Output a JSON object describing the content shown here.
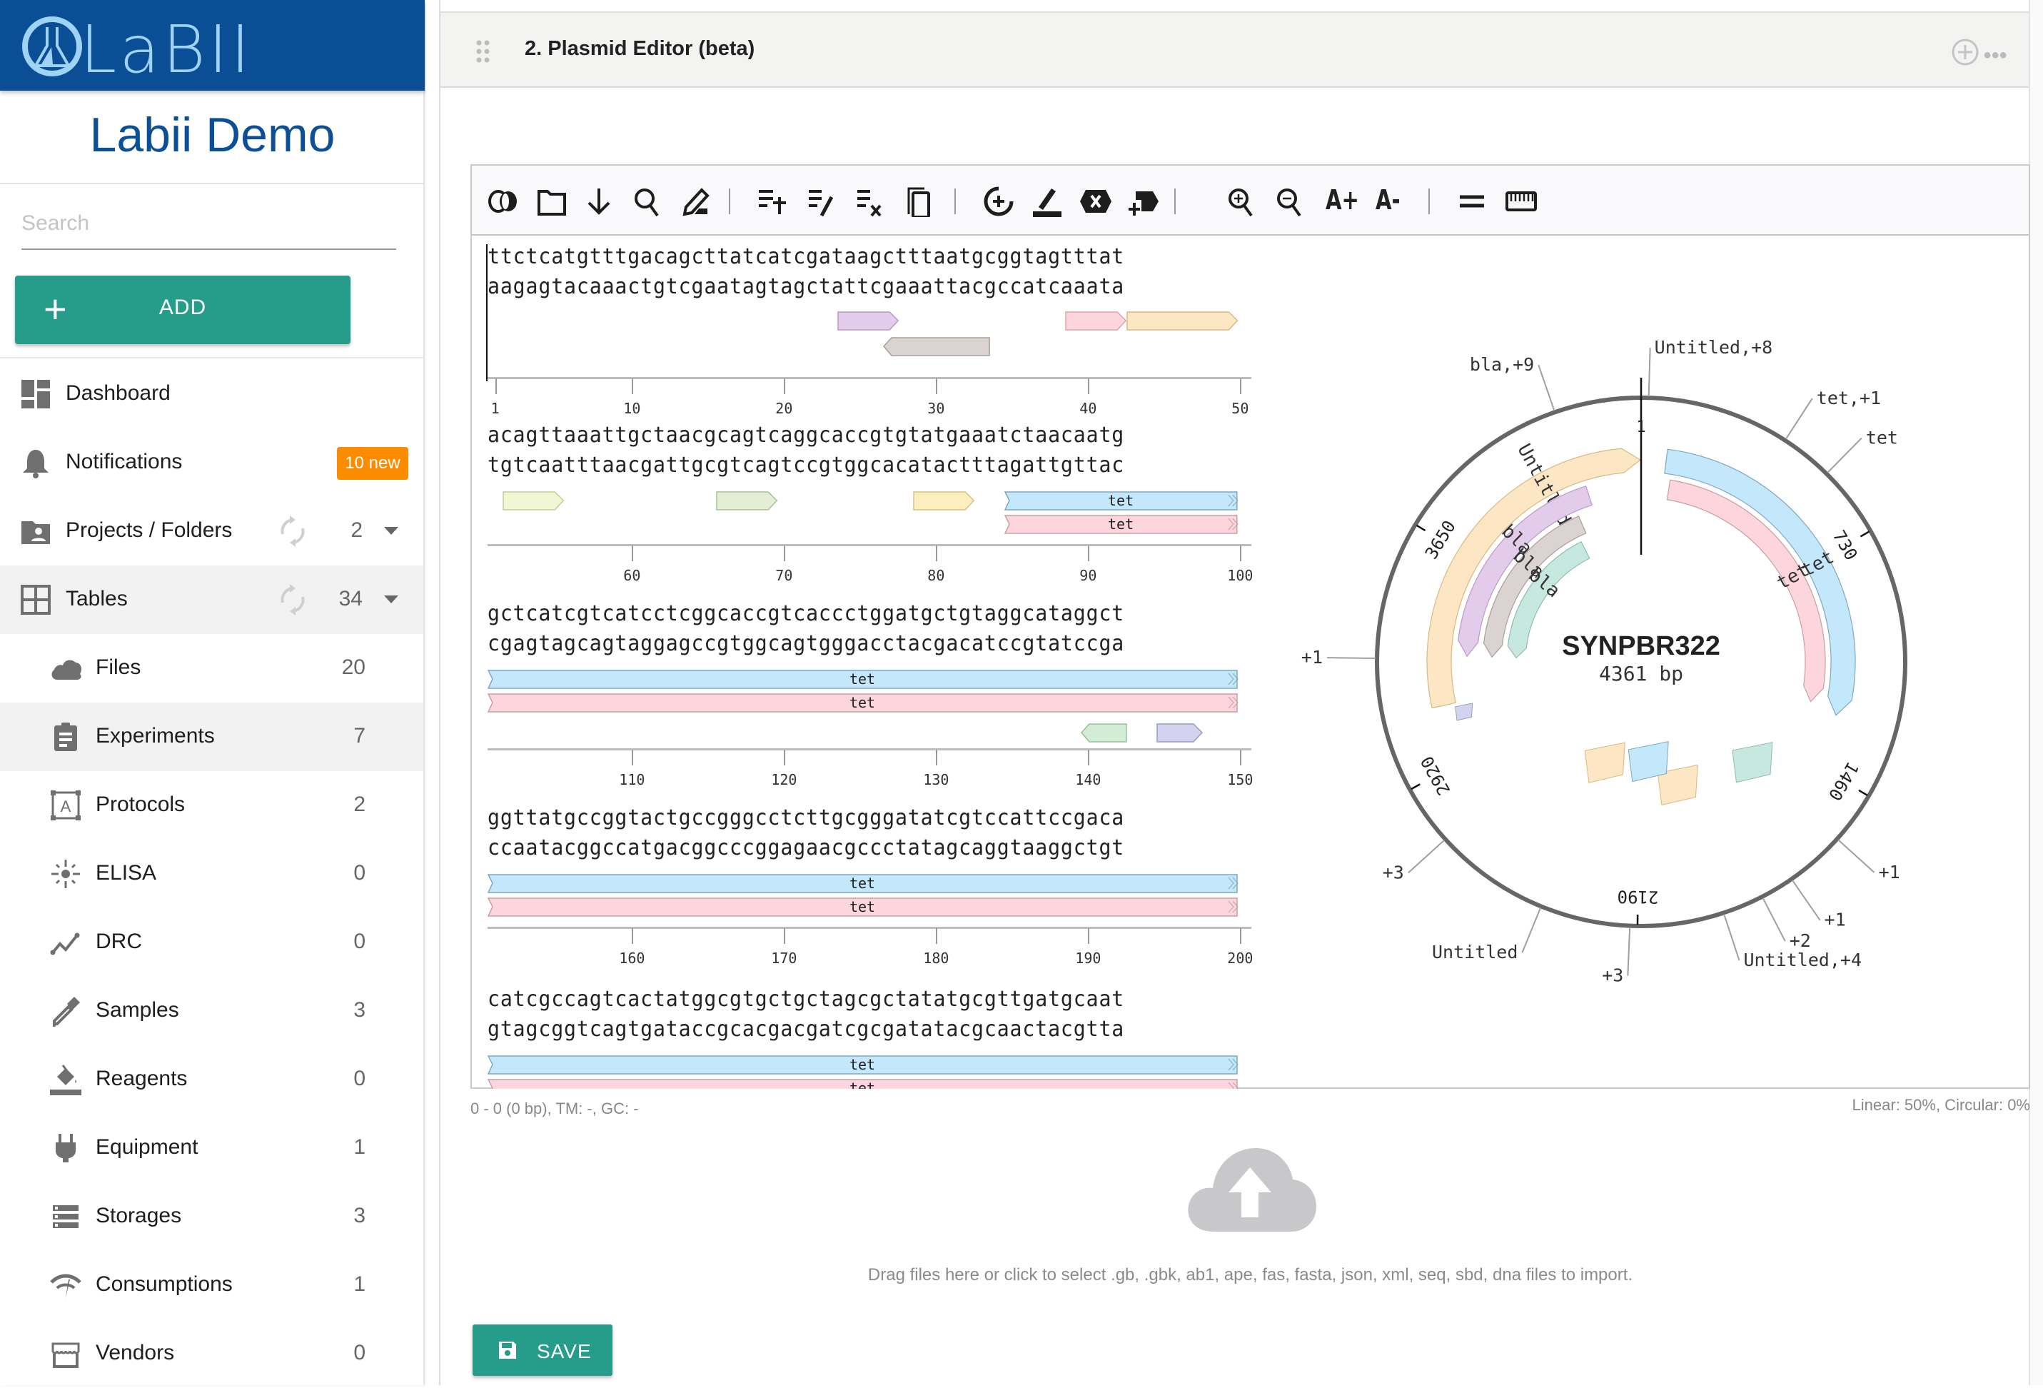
{
  "brand": {
    "logo_text": "LaBII",
    "org_name": "Labii Demo",
    "header_color": "#0a4f96"
  },
  "sidebar": {
    "search_placeholder": "Search",
    "search_value": "",
    "add_button": {
      "icon": "plus-icon",
      "label": "ADD"
    },
    "items": [
      {
        "id": "dashboard",
        "label": "Dashboard",
        "icon": "dashboard-icon",
        "level": 0
      },
      {
        "id": "notifications",
        "label": "Notifications",
        "icon": "bell-icon",
        "badge": "10 new",
        "level": 0
      },
      {
        "id": "projects",
        "label": "Projects / Folders",
        "icon": "folder-shared-icon",
        "count": "2",
        "sync": true,
        "expandable": true,
        "level": 0
      },
      {
        "id": "tables",
        "label": "Tables",
        "icon": "grid-icon",
        "count": "34",
        "sync": true,
        "expandable": true,
        "active": true,
        "level": 0
      },
      {
        "id": "files",
        "label": "Files",
        "icon": "cloud-icon",
        "count": "20",
        "level": 1
      },
      {
        "id": "experiments",
        "label": "Experiments",
        "icon": "clipboard-icon",
        "count": "7",
        "active": true,
        "level": 1
      },
      {
        "id": "protocols",
        "label": "Protocols",
        "icon": "text-box-icon",
        "count": "2",
        "level": 1
      },
      {
        "id": "elisa",
        "label": "ELISA",
        "icon": "sun-burst-icon",
        "count": "0",
        "level": 1
      },
      {
        "id": "drc",
        "label": "DRC",
        "icon": "line-chart-icon",
        "count": "0",
        "level": 1
      },
      {
        "id": "samples",
        "label": "Samples",
        "icon": "pipette-icon",
        "count": "3",
        "level": 1
      },
      {
        "id": "reagents",
        "label": "Reagents",
        "icon": "paint-bucket-icon",
        "count": "0",
        "level": 1
      },
      {
        "id": "equipment",
        "label": "Equipment",
        "icon": "plug-icon",
        "count": "1",
        "level": 1
      },
      {
        "id": "storages",
        "label": "Storages",
        "icon": "storage-icon",
        "count": "3",
        "level": 1
      },
      {
        "id": "consumptions",
        "label": "Consumptions",
        "icon": "gauge-icon",
        "count": "1",
        "level": 1
      },
      {
        "id": "vendors",
        "label": "Vendors",
        "icon": "store-icon",
        "count": "0",
        "level": 1
      }
    ],
    "badge_color": "#fb8c00",
    "accent_color": "#259d8a"
  },
  "panel": {
    "title": "2. Plasmid Editor (beta)",
    "add_icon": "add-circle-icon",
    "more_icon": "more-icon"
  },
  "toolbar": {
    "buttons": [
      {
        "id": "view-toggle",
        "icon": "circular-linear-view-icon"
      },
      {
        "id": "open",
        "icon": "folder-icon"
      },
      {
        "id": "download",
        "icon": "download-arrow-icon"
      },
      {
        "id": "find",
        "icon": "search-icon"
      },
      {
        "id": "edit",
        "icon": "pencil-icon"
      },
      {
        "sep": true
      },
      {
        "id": "add-feature",
        "icon": "list-add-icon"
      },
      {
        "id": "edit-feature",
        "icon": "list-edit-icon"
      },
      {
        "id": "remove-feature",
        "icon": "list-remove-icon"
      },
      {
        "id": "copy",
        "icon": "copy-icon"
      },
      {
        "sep": true
      },
      {
        "id": "add-primer",
        "icon": "circle-plus-icon"
      },
      {
        "id": "highlight",
        "icon": "highlight-icon"
      },
      {
        "id": "delete",
        "icon": "hex-x-icon"
      },
      {
        "id": "insert",
        "icon": "label-plus-icon"
      },
      {
        "sep": true
      },
      {
        "id": "zoom-in",
        "icon": "zoom-in-icon"
      },
      {
        "id": "zoom-out",
        "icon": "zoom-out-icon"
      },
      {
        "id": "font-increase",
        "text": "A+"
      },
      {
        "id": "font-decrease",
        "text": "A-"
      },
      {
        "sep": true
      },
      {
        "id": "complement-toggle",
        "icon": "equals-icon"
      },
      {
        "id": "ruler-toggle",
        "icon": "ruler-icon"
      }
    ]
  },
  "sequence": {
    "rows": [
      {
        "top": "ttctcatgtttgacagcttatcatcgataagctttaatgcggtagtttat",
        "bottom": "aagagtacaaactgtcgaatagtagctattcgaaattacgccatcaaata",
        "start": 1,
        "ticks": [
          1,
          10,
          20,
          30,
          40,
          50
        ],
        "features": [
          {
            "from": 24,
            "to": 27,
            "dir": "fwd",
            "lane": 0,
            "color": "#e3cbec",
            "stroke": "#b89cc4",
            "label": ""
          },
          {
            "from": 27,
            "to": 33,
            "dir": "rev",
            "lane": 1,
            "color": "#dbd3d1",
            "stroke": "#a89f9c",
            "label": ""
          },
          {
            "from": 39,
            "to": 42,
            "dir": "fwd",
            "lane": 0,
            "color": "#fdd5dc",
            "stroke": "#dca3ad",
            "label": ""
          },
          {
            "from": 43,
            "to": 50,
            "dir": "fwd",
            "lane": 0,
            "color": "#fde6c4",
            "stroke": "#d8b984",
            "label": ""
          }
        ]
      },
      {
        "top": "acagttaaattgctaacgcagtcaggcaccgtgtatgaaatctaacaatg",
        "bottom": "tgtcaatttaacgattgcgtcagtccgtggcacatactttagattgttac",
        "start": 51,
        "ticks": [
          60,
          70,
          80,
          90,
          100
        ],
        "features": [
          {
            "from": 52,
            "to": 55,
            "dir": "fwd",
            "lane": 0,
            "color": "#f1f7d5",
            "stroke": "#c5cc96",
            "label": ""
          },
          {
            "from": 66,
            "to": 69,
            "dir": "fwd",
            "lane": 0,
            "color": "#e3eed4",
            "stroke": "#a9bf96",
            "label": ""
          },
          {
            "from": 79,
            "to": 82,
            "dir": "fwd",
            "lane": 0,
            "color": "#fdeec0",
            "stroke": "#d8c27b",
            "label": ""
          },
          {
            "from": 85,
            "to": 100,
            "dir": "cont",
            "lane": 0,
            "color": "#c4e8fb",
            "stroke": "#7fa8c0",
            "label": "tet"
          },
          {
            "from": 85,
            "to": 100,
            "dir": "cont",
            "lane": 1,
            "color": "#fdd5dc",
            "stroke": "#c7a0a7",
            "label": "tet"
          }
        ]
      },
      {
        "top": "gctcatcgtcatcctcggcaccgtcaccctggatgctgtaggcataggct",
        "bottom": "cgagtagcagtaggagccgtggcagtgggacctacgacatccgtatccga",
        "start": 101,
        "ticks": [
          110,
          120,
          130,
          140,
          150
        ],
        "features": [
          {
            "from": 101,
            "to": 150,
            "dir": "cont",
            "lane": 0,
            "color": "#c4e8fb",
            "stroke": "#7fa8c0",
            "label": "tet"
          },
          {
            "from": 101,
            "to": 150,
            "dir": "cont",
            "lane": 1,
            "color": "#fdd5dc",
            "stroke": "#c7a0a7",
            "label": "tet"
          },
          {
            "from": 140,
            "to": 142,
            "dir": "rev",
            "lane": 2,
            "color": "#d3ecd5",
            "stroke": "#98bf9b",
            "label": ""
          },
          {
            "from": 145,
            "to": 147,
            "dir": "fwd",
            "lane": 2,
            "color": "#d3d3f0",
            "stroke": "#9a9ac4",
            "label": ""
          }
        ]
      },
      {
        "top": "ggttatgccggtactgccgggcctcttgcgggatatcgtccattccgaca",
        "bottom": "ccaatacggccatgacggcccggagaacgccctatagcaggtaaggctgt",
        "start": 151,
        "ticks": [
          160,
          170,
          180,
          190,
          200
        ],
        "features": [
          {
            "from": 151,
            "to": 200,
            "dir": "cont",
            "lane": 0,
            "color": "#c4e8fb",
            "stroke": "#7fa8c0",
            "label": "tet"
          },
          {
            "from": 151,
            "to": 200,
            "dir": "cont",
            "lane": 1,
            "color": "#fdd5dc",
            "stroke": "#c7a0a7",
            "label": "tet"
          }
        ]
      },
      {
        "top": "catcgccagtcactatggcgtgctgctagcgctatatgcgttgatgcaat",
        "bottom": "gtagcggtcagtgataccgcacgacgatcgcgatatacgcaactacgtta",
        "start": 201,
        "ticks": [],
        "features": [
          {
            "from": 201,
            "to": 250,
            "dir": "cont",
            "lane": 0,
            "color": "#c4e8fb",
            "stroke": "#7fa8c0",
            "label": "tet"
          },
          {
            "from": 201,
            "to": 250,
            "dir": "cont",
            "lane": 1,
            "color": "#fdd5dc",
            "stroke": "#c7a0a7",
            "label": "tet"
          }
        ]
      }
    ]
  },
  "plasmid": {
    "name": "SYNPBR322",
    "length_label": "4361 bp",
    "length": 4361,
    "cursor_label": "1",
    "ticks": [
      {
        "pos": 730,
        "label": "730"
      },
      {
        "pos": 1460,
        "label": "1460"
      },
      {
        "pos": 2190,
        "label": "2190"
      },
      {
        "pos": 2920,
        "label": "2920"
      },
      {
        "pos": 3650,
        "label": "3650"
      }
    ],
    "arcs": [
      {
        "label": "tet",
        "start": 86,
        "end": 1276,
        "lane": 0,
        "dir": "fwd",
        "color": "#c4e8fb",
        "stroke": "#7fa8c0"
      },
      {
        "label": "tet",
        "start": 110,
        "end": 1250,
        "lane": 1,
        "dir": "fwd",
        "color": "#fdd5dc",
        "stroke": "#c7a0a7"
      },
      {
        "label": "Untitled",
        "start": 3120,
        "end": 4358,
        "lane": 0,
        "dir": "fwd",
        "color": "#fde6c4",
        "stroke": "#d8b984"
      },
      {
        "label": "bla",
        "start": 3293,
        "end": 4150,
        "lane": 1,
        "dir": "rev",
        "color": "#e3cbec",
        "stroke": "#b89cc4"
      },
      {
        "label": "bla",
        "start": 3293,
        "end": 4080,
        "lane": 2,
        "dir": "rev",
        "color": "#dbd3d1",
        "stroke": "#a89f9c"
      },
      {
        "label": "bla",
        "start": 3293,
        "end": 4040,
        "lane": 3,
        "dir": "rev",
        "color": "#c6e8de",
        "stroke": "#8fbdaf"
      }
    ],
    "outer_labels": [
      {
        "text": "Untitled,+8",
        "pos": 20,
        "side": "right"
      },
      {
        "text": "bla,+9",
        "pos": 4130,
        "side": "left"
      },
      {
        "text": "tet,+1",
        "pos": 400,
        "side": "right"
      },
      {
        "text": "tet",
        "pos": 540,
        "side": "right"
      },
      {
        "text": "+1",
        "pos": 3280,
        "side": "left"
      },
      {
        "text": "+1",
        "pos": 1600,
        "side": "right"
      },
      {
        "text": "+1",
        "pos": 1760,
        "side": "right"
      },
      {
        "text": "+2",
        "pos": 1850,
        "side": "right"
      },
      {
        "text": "Untitled,+4",
        "pos": 1960,
        "side": "right"
      },
      {
        "text": "+3",
        "pos": 2210,
        "side": "left"
      },
      {
        "text": "Untitled",
        "pos": 2450,
        "side": "left"
      },
      {
        "text": "+3",
        "pos": 2760,
        "side": "left"
      }
    ]
  },
  "status": {
    "selection": "0 - 0 (0 bp), TM: -, GC: -",
    "zoom": "Linear: 50%, Circular: 0%"
  },
  "dropzone": {
    "icon": "cloud-upload-icon",
    "text": "Drag files here or click to select .gb, .gbk, ab1, ape, fas, fasta, json, xml, seq, sbd, dna files to import."
  },
  "save_button": {
    "icon": "save-icon",
    "label": "SAVE"
  }
}
